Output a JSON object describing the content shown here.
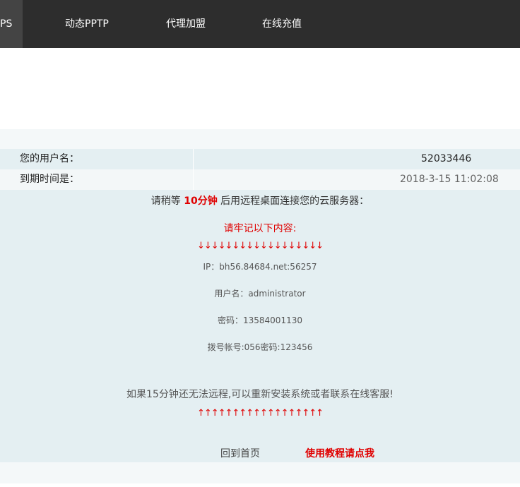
{
  "nav": {
    "items": [
      {
        "label": "PS",
        "active": true
      },
      {
        "label": "动态PPTP"
      },
      {
        "label": "代理加盟"
      },
      {
        "label": "在线充值"
      }
    ]
  },
  "colors": {
    "nav_bg": "#2d2d2d",
    "nav_active_bg": "#444444",
    "panel_bg": "#e4eff2",
    "highlight": "#e00000"
  },
  "account": {
    "username_label": "您的用户名：",
    "username_value": "52033446",
    "expiry_label": "到期时间是：",
    "expiry_value": "2018-3-15 11:02:08"
  },
  "instructions": {
    "wait_prefix": "请稍等 ",
    "wait_highlight": "10分钟",
    "wait_suffix": " 后用远程桌面连接您的云服务器：",
    "remember": "请牢记以下内容:",
    "arrows_down": "↓↓↓↓↓↓↓↓↓↓↓↓↓↓↓↓↓↓",
    "ip": "IP：bh56.84684.net:56257",
    "username": "用户名：administrator",
    "password": "密码：13584001130",
    "dial": "拨号帐号:056密码:123456",
    "warning": "如果15分钟还无法远程,可以重新安装系统或者联系在线客服!",
    "arrows_up": "↑↑↑↑↑↑↑↑↑↑↑↑↑↑↑↑↑↑"
  },
  "links": {
    "home": "回到首页",
    "tutorial": "使用教程请点我"
  }
}
